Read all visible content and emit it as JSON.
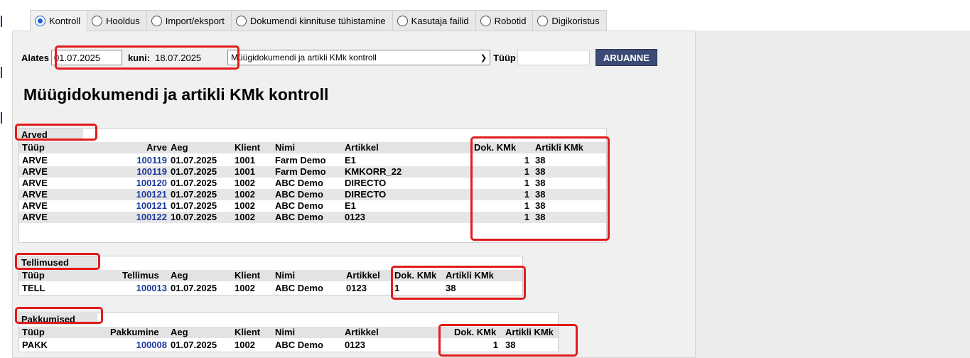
{
  "tabs": [
    {
      "label": "Kontroll",
      "active": true
    },
    {
      "label": "Hooldus",
      "active": false
    },
    {
      "label": "Import/eksport",
      "active": false
    },
    {
      "label": "Dokumendi kinnituse tühistamine",
      "active": false
    },
    {
      "label": "Kasutaja failid",
      "active": false
    },
    {
      "label": "Robotid",
      "active": false
    },
    {
      "label": "Digikoristus",
      "active": false
    }
  ],
  "filter": {
    "from_label": "Alates",
    "from_value": "01.07.2025",
    "to_label": "kuni:",
    "to_value": "18.07.2025",
    "report_select": "Müügidokumendi ja artikli KMk kontroll",
    "type_label": "Tüüp",
    "type_value": "",
    "report_button": "ARUANNE"
  },
  "page_title": "Müügidokumendi ja artikli KMk kontroll",
  "arved": {
    "section": "Arved",
    "headers": [
      "Tüüp",
      "Arve",
      "Aeg",
      "Klient",
      "Nimi",
      "Artikkel",
      "Dok. KMk",
      "Artikli KMk"
    ],
    "rows": [
      [
        "ARVE",
        "100119",
        "01.07.2025",
        "1001",
        "Farm Demo",
        "E1",
        "1",
        "38"
      ],
      [
        "ARVE",
        "100119",
        "01.07.2025",
        "1001",
        "Farm Demo",
        "KMKORR_22",
        "1",
        "38"
      ],
      [
        "ARVE",
        "100120",
        "01.07.2025",
        "1002",
        "ABC Demo",
        "DIRECTO",
        "1",
        "38"
      ],
      [
        "ARVE",
        "100121",
        "01.07.2025",
        "1002",
        "ABC Demo",
        "DIRECTO",
        "1",
        "38"
      ],
      [
        "ARVE",
        "100121",
        "01.07.2025",
        "1002",
        "ABC Demo",
        "E1",
        "1",
        "38"
      ],
      [
        "ARVE",
        "100122",
        "10.07.2025",
        "1002",
        "ABC Demo",
        "0123",
        "1",
        "38"
      ]
    ]
  },
  "tellimused": {
    "section": "Tellimused",
    "headers": [
      "Tüüp",
      "Tellimus",
      "Aeg",
      "Klient",
      "Nimi",
      "Artikkel",
      "Dok. KMk",
      "Artikli KMk"
    ],
    "rows": [
      [
        "TELL",
        "100013",
        "01.07.2025",
        "1002",
        "ABC Demo",
        "0123",
        "1",
        "38"
      ]
    ]
  },
  "pakkumised": {
    "section": "Pakkumised",
    "headers": [
      "Tüüp",
      "Pakkumine",
      "Aeg",
      "Klient",
      "Nimi",
      "Artikkel",
      "Dok. KMk",
      "Artikli KMk"
    ],
    "rows": [
      [
        "PAKK",
        "100008",
        "01.07.2025",
        "1002",
        "ABC Demo",
        "0123",
        "1",
        "38"
      ]
    ]
  },
  "colors": {
    "highlight": "#e21b1b",
    "link": "#1e3a9e",
    "button": "#3c4a75"
  }
}
